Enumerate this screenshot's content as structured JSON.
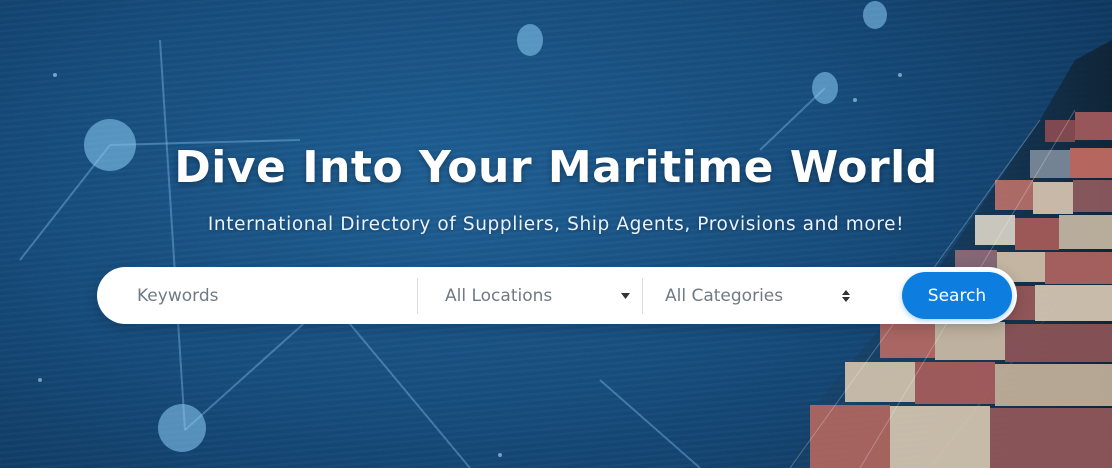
{
  "hero": {
    "title": "Dive Into Your Maritime World",
    "subtitle": "International Directory of Suppliers, Ship Agents, Provisions and more!"
  },
  "search": {
    "keywords_placeholder": "Keywords",
    "keywords_value": "",
    "location_selected": "All Locations",
    "category_selected": "All Categories",
    "submit_label": "Search"
  },
  "colors": {
    "ocean": "#164c7c",
    "accent": "#0d7de0",
    "text_light": "#ffffff"
  },
  "icons": {
    "location_dropdown": "caret-down-icon",
    "category_dropdown": "sort-updown-icon"
  }
}
